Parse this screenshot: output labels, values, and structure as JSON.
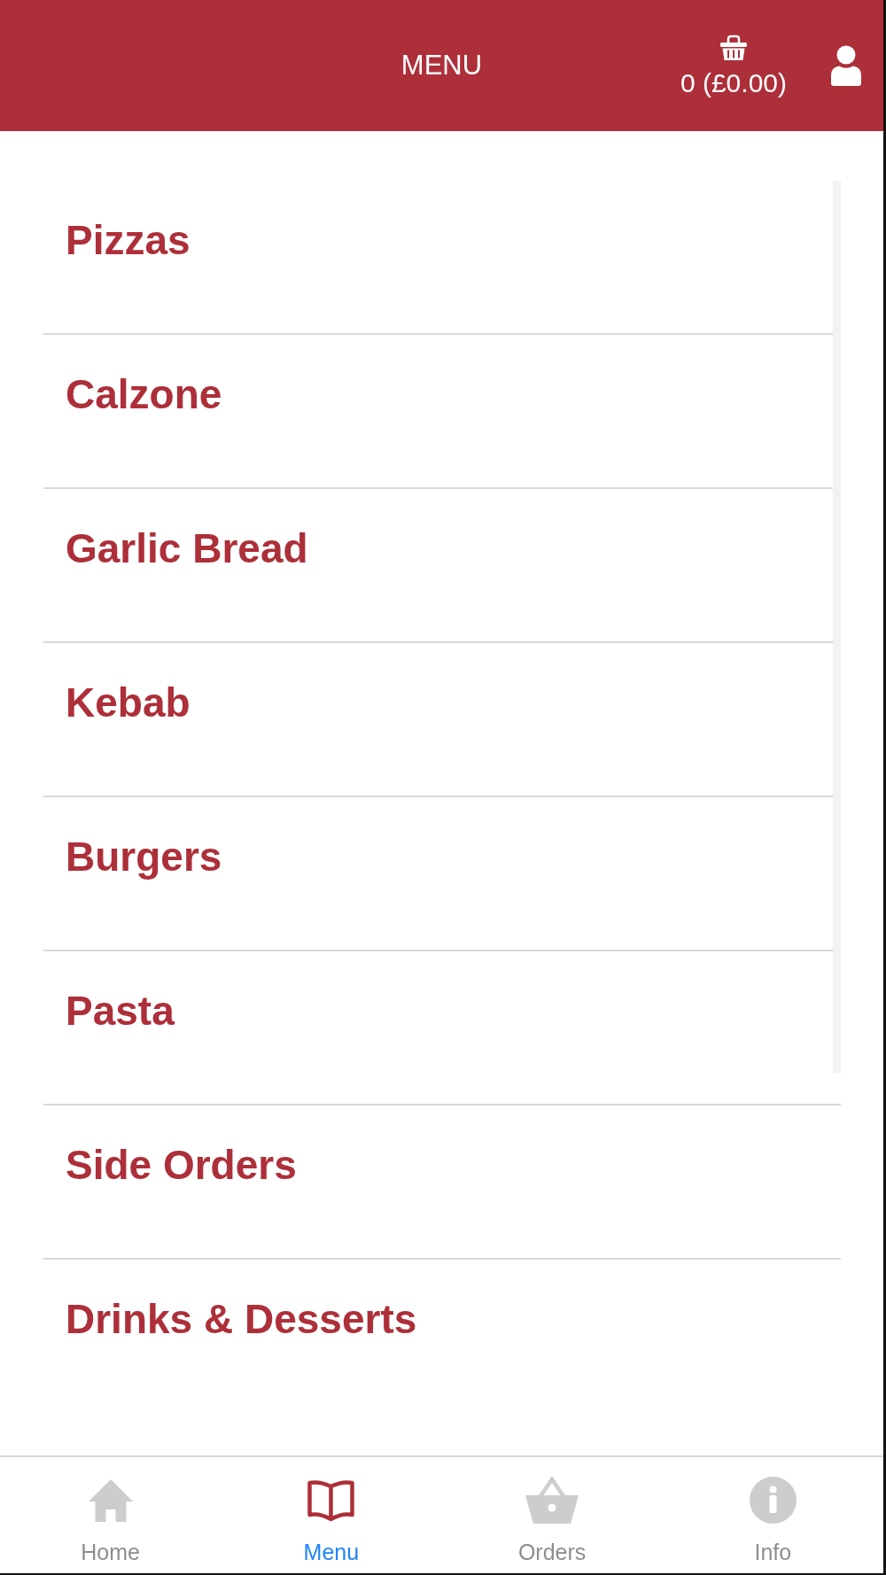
{
  "header": {
    "title": "MENU",
    "cart_summary": "0 (£0.00)"
  },
  "categories": [
    "Pizzas",
    "Calzone",
    "Garlic Bread",
    "Kebab",
    "Burgers",
    "Pasta",
    "Side Orders",
    "Drinks & Desserts"
  ],
  "tab_bar": {
    "tabs": [
      {
        "label": "Home",
        "selected": false
      },
      {
        "label": "Menu",
        "selected": true
      },
      {
        "label": "Orders",
        "selected": false
      },
      {
        "label": "Info",
        "selected": false
      }
    ]
  }
}
